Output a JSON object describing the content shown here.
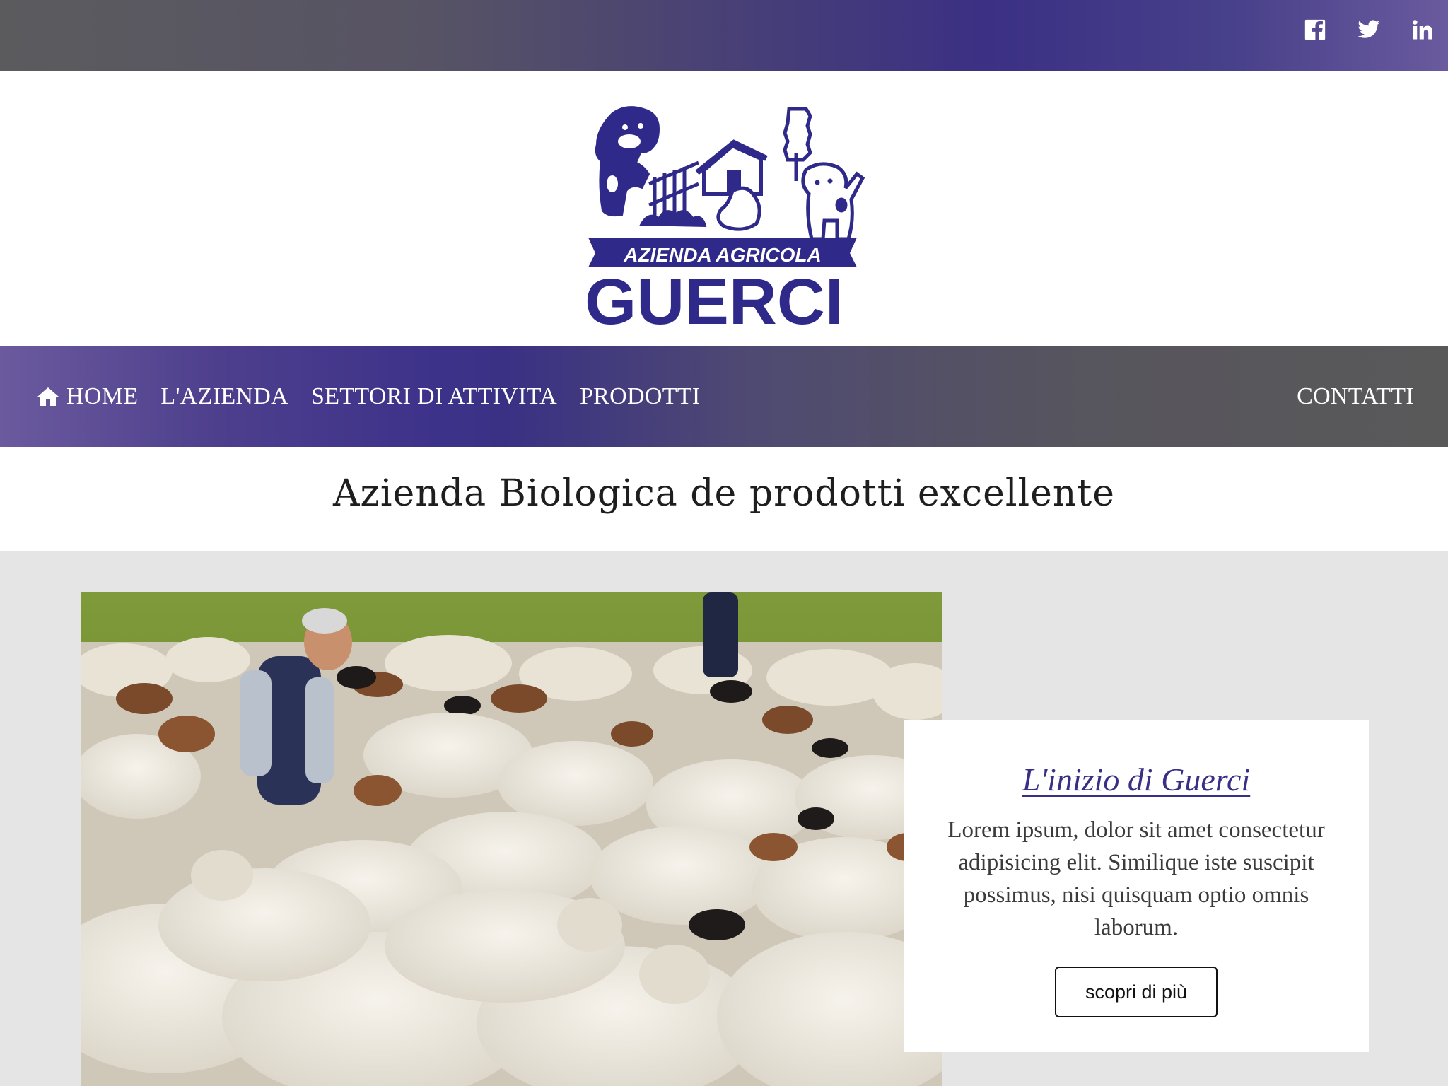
{
  "topbar": {
    "social": [
      {
        "icon": "facebook-icon"
      },
      {
        "icon": "twitter-icon"
      },
      {
        "icon": "linkedin-icon"
      }
    ]
  },
  "logo": {
    "line1": "AZIENDA AGRICOLA",
    "line2": "GUERCI",
    "color": "#2f2a8a"
  },
  "nav": {
    "items": [
      {
        "label": "HOME",
        "icon": "home-icon"
      },
      {
        "label": "L'AZIENDA"
      },
      {
        "label": "SETTORI DI ATTIVITA"
      },
      {
        "label": "PRODOTTI"
      }
    ],
    "right_label": "CONTATTI"
  },
  "tagline": "Azienda Biologica de prodotti excellente",
  "card": {
    "title": "L'inizio di Guerci",
    "text": "Lorem ipsum, dolor sit amet consectetur adipisicing elit. Similique iste suscipit possimus, nisi quisquam optio omnis laborum.",
    "button": "scopri di più"
  },
  "colors": {
    "accent": "#3a2f86",
    "content_bg": "#e5e5e5"
  }
}
